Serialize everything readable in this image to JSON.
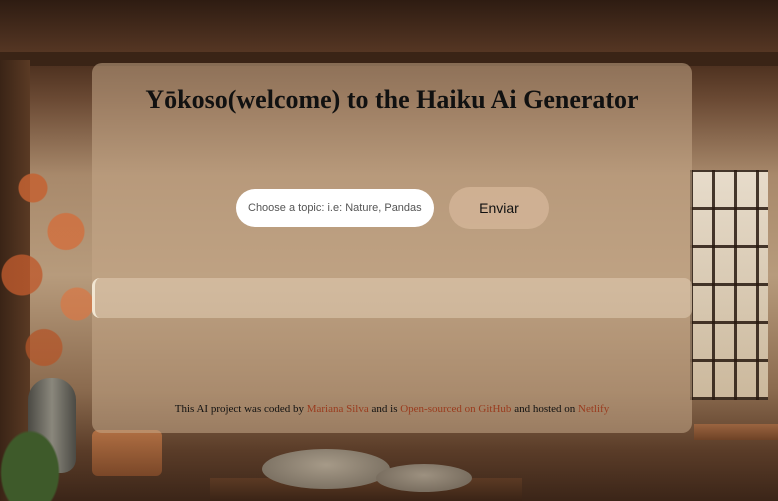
{
  "header": {
    "title": "Yōkoso(welcome) to the Haiku Ai Generator"
  },
  "form": {
    "input_placeholder": "Choose a topic: i.e: Nature, Pandas",
    "input_value": "",
    "submit_label": "Enviar"
  },
  "output": {
    "text": ""
  },
  "footer": {
    "prefix": "This AI project was coded by ",
    "author_link": "Mariana Silva",
    "middle": " and is ",
    "github_link": "Open-sourced on GitHub",
    "hosted": " and hosted on ",
    "netlify_link": "Netlify"
  },
  "colors": {
    "link": "#9a3b1e",
    "card_bg": "#c4a888"
  }
}
